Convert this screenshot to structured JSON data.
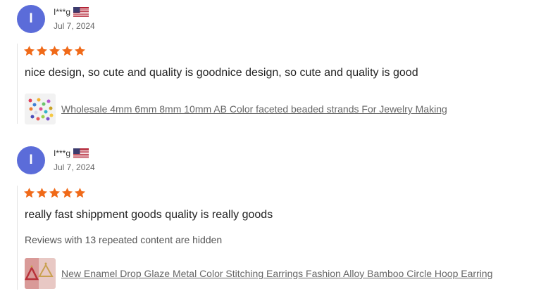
{
  "reviews": [
    {
      "avatar_letter": "I",
      "username": "I***g",
      "country_flag": "us-flag-icon",
      "date": "Jul 7, 2024",
      "rating": 5,
      "text": "nice design, so cute and quality is goodnice design, so cute and quality is good",
      "hidden_note": "",
      "product_title": "Wholesale 4mm 6mm 8mm 10mm AB Color faceted beaded strands For Jewelry Making"
    },
    {
      "avatar_letter": "I",
      "username": "I***g",
      "country_flag": "us-flag-icon",
      "date": "Jul 7, 2024",
      "rating": 5,
      "text": "really fast shippment goods quality is really goods",
      "hidden_note": "Reviews with 13 repeated content are hidden",
      "product_title": "New Enamel Drop Glaze Metal Color Stitching Earrings Fashion Alloy Bamboo Circle Hoop Earring"
    }
  ],
  "colors": {
    "avatar": "#5b6cd9",
    "star": "#f06a19",
    "link": "#666666"
  }
}
